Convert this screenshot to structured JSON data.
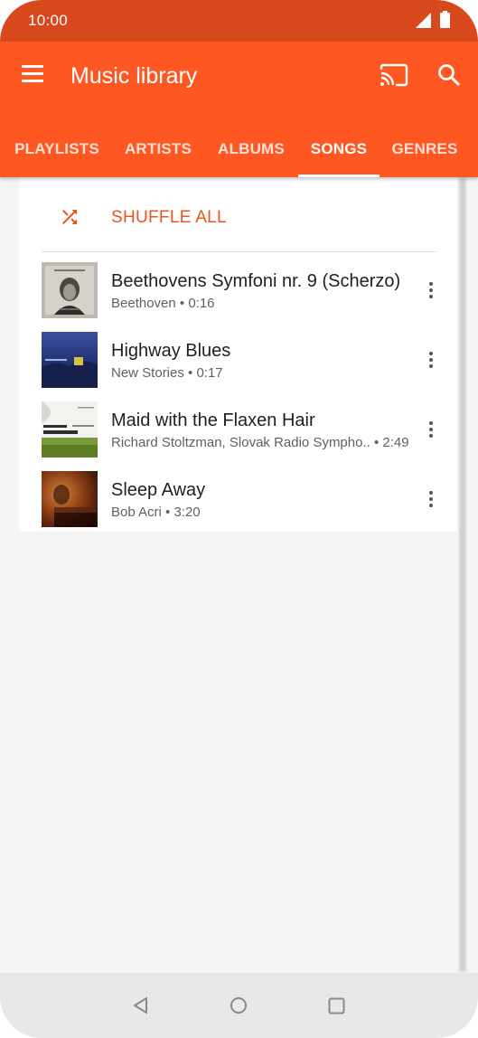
{
  "status_bar": {
    "time": "10:00"
  },
  "app_bar": {
    "title": "Music library",
    "tabs": [
      {
        "label": "PLAYLISTS",
        "active": false
      },
      {
        "label": "ARTISTS",
        "active": false
      },
      {
        "label": "ALBUMS",
        "active": false
      },
      {
        "label": "SONGS",
        "active": true
      },
      {
        "label": "GENRES",
        "active": false
      }
    ]
  },
  "shuffle": {
    "label": "SHUFFLE ALL",
    "icon": "shuffle-icon"
  },
  "songs": [
    {
      "title": "Beethovens Symfoni nr. 9 (Scherzo)",
      "subtitle": "Beethoven • 0:16",
      "art": "beethoven-album-art"
    },
    {
      "title": "Highway Blues",
      "subtitle": "New Stories • 0:17",
      "art": "night-sky-album-art"
    },
    {
      "title": "Maid with the Flaxen Hair",
      "subtitle": "Richard Stoltzman, Slovak Radio Sympho.. • 2:49",
      "art": "richard-stoltzman-album-art"
    },
    {
      "title": "Sleep Away",
      "subtitle": "Bob Acri • 3:20",
      "art": "piano-album-art"
    }
  ],
  "colors": {
    "status_bar": "#d8491e",
    "app_bar": "#ff5722",
    "accent": "#e8551e"
  },
  "icons": [
    "signal-icon",
    "battery-icon",
    "menu-icon",
    "cast-icon",
    "search-icon",
    "more-vert-icon",
    "nav-back-icon",
    "nav-home-icon",
    "nav-recent-icon"
  ]
}
